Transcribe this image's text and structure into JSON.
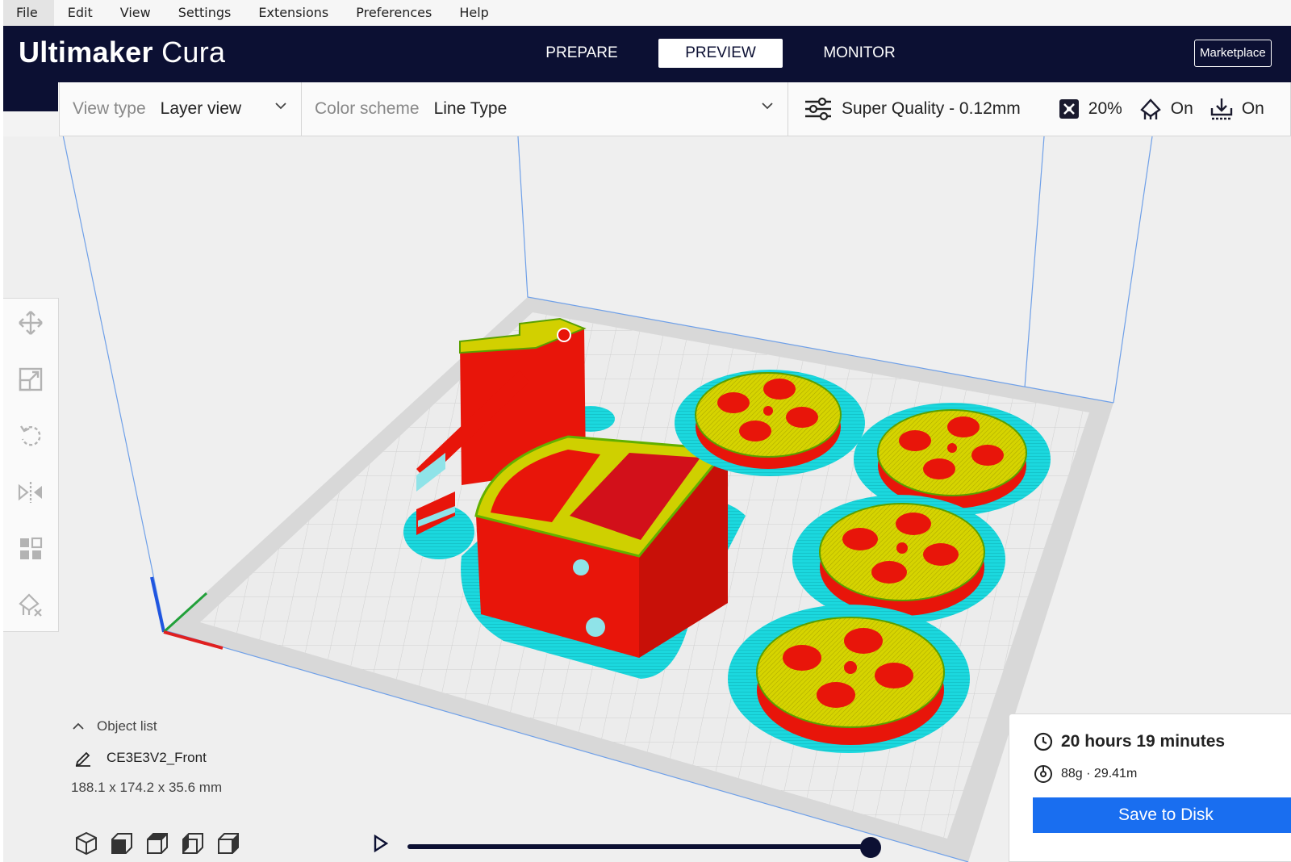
{
  "menu": {
    "items": [
      "File",
      "Edit",
      "View",
      "Settings",
      "Extensions",
      "Preferences",
      "Help"
    ]
  },
  "header": {
    "logo_bold": "Ultimaker",
    "logo_light": "Cura",
    "stages": [
      "PREPARE",
      "PREVIEW",
      "MONITOR"
    ],
    "active_stage": "PREVIEW",
    "marketplace_label": "Marketplace"
  },
  "toolbar": {
    "view_type_label": "View type",
    "view_type_value": "Layer view",
    "color_scheme_label": "Color scheme",
    "color_scheme_value": "Line Type",
    "quality": "Super Quality - 0.12mm",
    "infill": "20%",
    "support": "On",
    "adhesion": "On"
  },
  "left_tools": [
    "move-icon",
    "scale-icon",
    "rotate-icon",
    "mirror-icon",
    "per-model-settings-icon",
    "support-blocker-icon"
  ],
  "object_list": {
    "header": "Object list",
    "object_name": "CE3E3V2_Front",
    "dimensions": "188.1 x 174.2 x 35.6 mm"
  },
  "camera_views": [
    "3d-view-icon",
    "front-view-icon",
    "top-view-icon",
    "left-view-icon",
    "right-view-icon"
  ],
  "layer_slider": {
    "position_fraction": 0.98
  },
  "print_info": {
    "time": "20 hours 19 minutes",
    "material": "88g · 29.41m",
    "save_label": "Save to Disk"
  },
  "colors": {
    "header_bg": "#0c1033",
    "accent_blue": "#196ef0",
    "wall_red": "#ff1d0c",
    "infill_yellow": "#cfd100",
    "skirt_cyan": "#16d4da"
  }
}
